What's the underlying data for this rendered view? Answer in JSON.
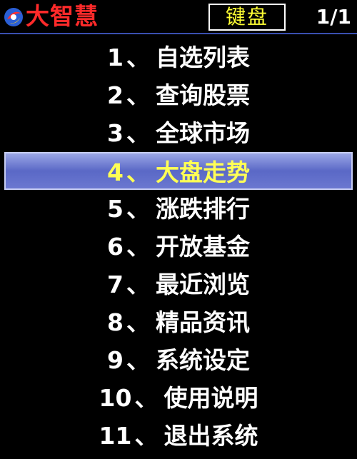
{
  "header": {
    "app_name": "大智慧",
    "mode_button_label": "键盘",
    "page_indicator": "1/1"
  },
  "menu": {
    "selected_index": 3,
    "items": [
      {
        "number": "1",
        "label": "自选列表"
      },
      {
        "number": "2",
        "label": "查询股票"
      },
      {
        "number": "3",
        "label": "全球市场"
      },
      {
        "number": "4",
        "label": "大盘走势"
      },
      {
        "number": "5",
        "label": "涨跌排行"
      },
      {
        "number": "6",
        "label": "开放基金"
      },
      {
        "number": "7",
        "label": "最近浏览"
      },
      {
        "number": "8",
        "label": "精品资讯"
      },
      {
        "number": "9",
        "label": "系统设定"
      },
      {
        "number": "10",
        "label": "使用说明"
      },
      {
        "number": "11",
        "label": "退出系统"
      }
    ],
    "separator": "、"
  },
  "colors": {
    "title_red": "#ff2a2a",
    "highlight_text_yellow": "#ffff55",
    "selection_blue": "#6b78d0",
    "background": "#000000"
  },
  "icons": {
    "logo": "dzh-logo-icon"
  }
}
